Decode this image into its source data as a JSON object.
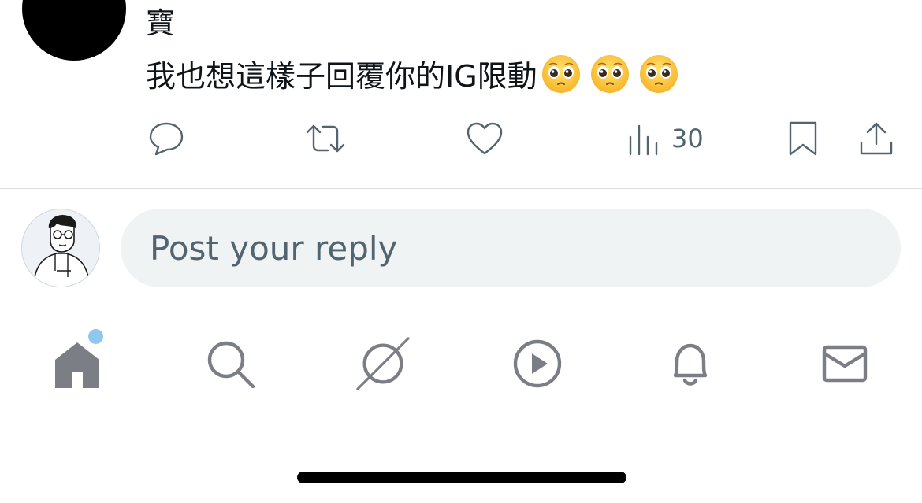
{
  "tweet": {
    "author_name": "寶",
    "text": "我也想這樣子回覆你的IG限動",
    "emojis": [
      "pleading-face-emoji",
      "pleading-face-emoji",
      "pleading-face-emoji"
    ],
    "actions": {
      "reply_icon": "speech-bubble-icon",
      "repost_icon": "repost-arrows-icon",
      "like_icon": "heart-icon",
      "views_icon": "bar-chart-icon",
      "views_count": "30",
      "bookmark_icon": "bookmark-icon",
      "share_icon": "share-upload-icon"
    }
  },
  "reply": {
    "placeholder": "Post your reply",
    "avatar_icon": "cartoon-person-with-glasses"
  },
  "tab_bar": {
    "items": [
      {
        "name": "home",
        "icon": "house-icon",
        "has_notification_dot": true
      },
      {
        "name": "search",
        "icon": "magnifier-icon"
      },
      {
        "name": "grok",
        "icon": "grok-slash-icon"
      },
      {
        "name": "video",
        "icon": "play-circle-icon"
      },
      {
        "name": "notifications",
        "icon": "bell-icon"
      },
      {
        "name": "messages",
        "icon": "envelope-icon"
      }
    ],
    "colors": {
      "icon": "#7b7f85",
      "notification_dot": "#8ec8f1"
    }
  },
  "colors": {
    "text": "#0f1419",
    "secondary": "#536471",
    "input_bg": "#eff3f4",
    "divider": "#dadee2"
  }
}
